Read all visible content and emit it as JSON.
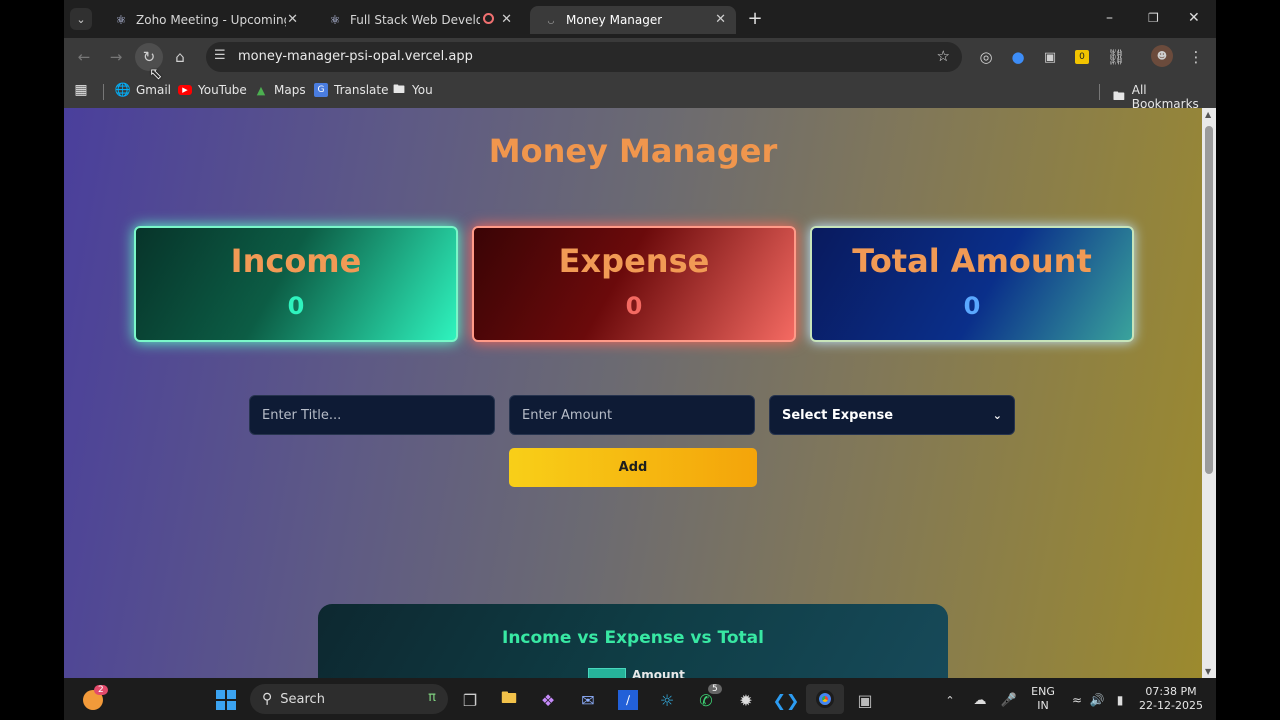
{
  "browser": {
    "tabs": [
      {
        "title": "Zoho Meeting - Upcoming Meetings",
        "active": false
      },
      {
        "title": "Full Stack Web Development",
        "active": false
      },
      {
        "title": "Money Manager",
        "active": true
      }
    ],
    "url": "money-manager-psi-opal.vercel.app",
    "bookmarks": [
      "Gmail",
      "YouTube",
      "Maps",
      "Translate",
      "You"
    ],
    "all_bookmarks": "All Bookmarks",
    "extension_badge": "0"
  },
  "app": {
    "title": "Money Manager",
    "cards": {
      "income": {
        "label": "Income",
        "value": "0",
        "color": "#2ff3be"
      },
      "expense": {
        "label": "Expense",
        "value": "0",
        "color": "#f46a62"
      },
      "total": {
        "label": "Total Amount",
        "value": "0",
        "color": "#5aa8ff"
      }
    },
    "form": {
      "title_placeholder": "Enter Title...",
      "amount_placeholder": "Enter Amount",
      "select_value": "Select Expense",
      "add_label": "Add"
    },
    "chart": {
      "title": "Income vs Expense vs Total",
      "legend_label": "Amount"
    }
  },
  "taskbar": {
    "search_label": "Search",
    "lang": "ENG",
    "region": "IN",
    "time": "07:38 PM",
    "date": "22-12-2025",
    "badge_widget": "2",
    "badge_whatsapp": "5"
  }
}
